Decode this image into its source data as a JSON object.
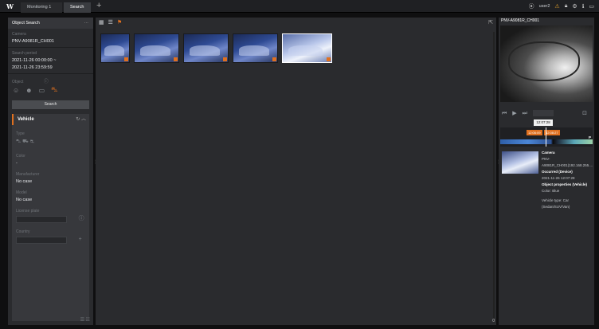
{
  "topbar": {
    "logo": "W",
    "tabs": [
      {
        "label": "Monitoring 1",
        "active": false
      },
      {
        "label": "Search",
        "active": true
      }
    ],
    "add_tab": "+",
    "user": "user2"
  },
  "left_panel": {
    "title": "Object Search",
    "more": "···",
    "camera_label": "Camera",
    "camera_value": "PNV-A9081R_CH001",
    "period_label": "Search period",
    "period_start": "2021-11-26 00:00:00 ~",
    "period_end": "2021-11-26 23:59:59",
    "object_label": "Object",
    "search_button": "Search",
    "vehicle": {
      "title": "Vehicle",
      "type_label": "Type",
      "color_label": "Color",
      "color_value": "-",
      "manufacturer_label": "Manufacturer",
      "manufacturer_value": "No case",
      "model_label": "Model",
      "model_value": "No case",
      "plate_label": "License plate",
      "plate_value": "",
      "country_label": "Country",
      "country_value": ""
    }
  },
  "center": {
    "thumbnail_count": 5,
    "selected_index": 4,
    "footer": "0"
  },
  "right_panel": {
    "camera_title": "PNV-A9081R_CH001",
    "tooltip_time": "12:07:28",
    "timeline_tags": [
      "12:06:09",
      "12:08:27"
    ],
    "timeline_end": "P",
    "info": {
      "camera_heading": "Camera",
      "camera_value": "PNV-A9081R_CH001(192.168.255....",
      "occurred_heading": "Occurred (Device)",
      "occurred_value": "2021-11-26 12:07:28",
      "props_heading": "Object properties  (Vehicle)",
      "color": "Color: Blue",
      "vehicle_type": "Vehicle type: Car (Sedan/SUV/Van)"
    }
  },
  "colors": {
    "accent": "#e0701f",
    "panel": "#2a2b2e",
    "background": "#0f0f10"
  }
}
